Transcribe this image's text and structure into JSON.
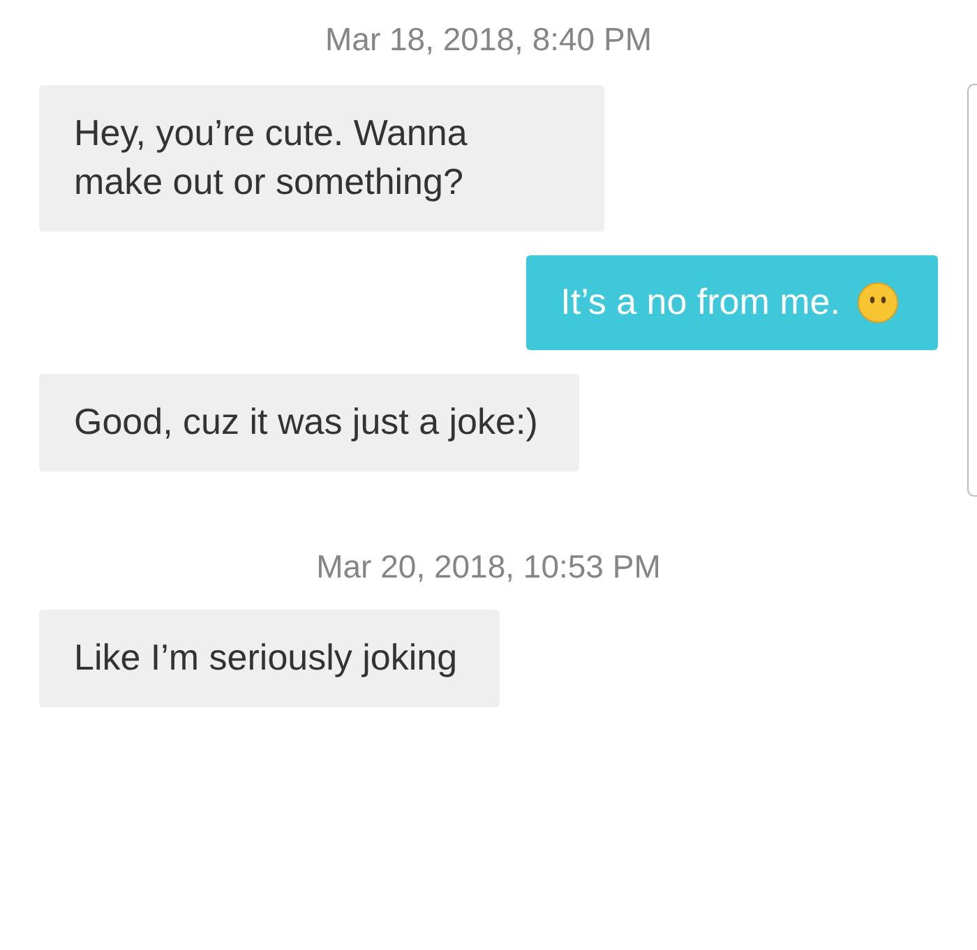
{
  "messages": [
    {
      "kind": "timestamp",
      "text": "Mar 18, 2018, 8:40 PM"
    },
    {
      "kind": "incoming",
      "text": "Hey, you’re cute. Wanna make out or something?",
      "emoji": false
    },
    {
      "kind": "outgoing",
      "text": "It’s a no from me.",
      "emoji": true
    },
    {
      "kind": "incoming",
      "text": "Good, cuz it was just a joke:)",
      "emoji": false
    },
    {
      "kind": "timestamp",
      "text": "Mar 20, 2018, 10:53 PM"
    },
    {
      "kind": "incoming",
      "text": "Like I’m seriously joking",
      "emoji": false
    }
  ]
}
